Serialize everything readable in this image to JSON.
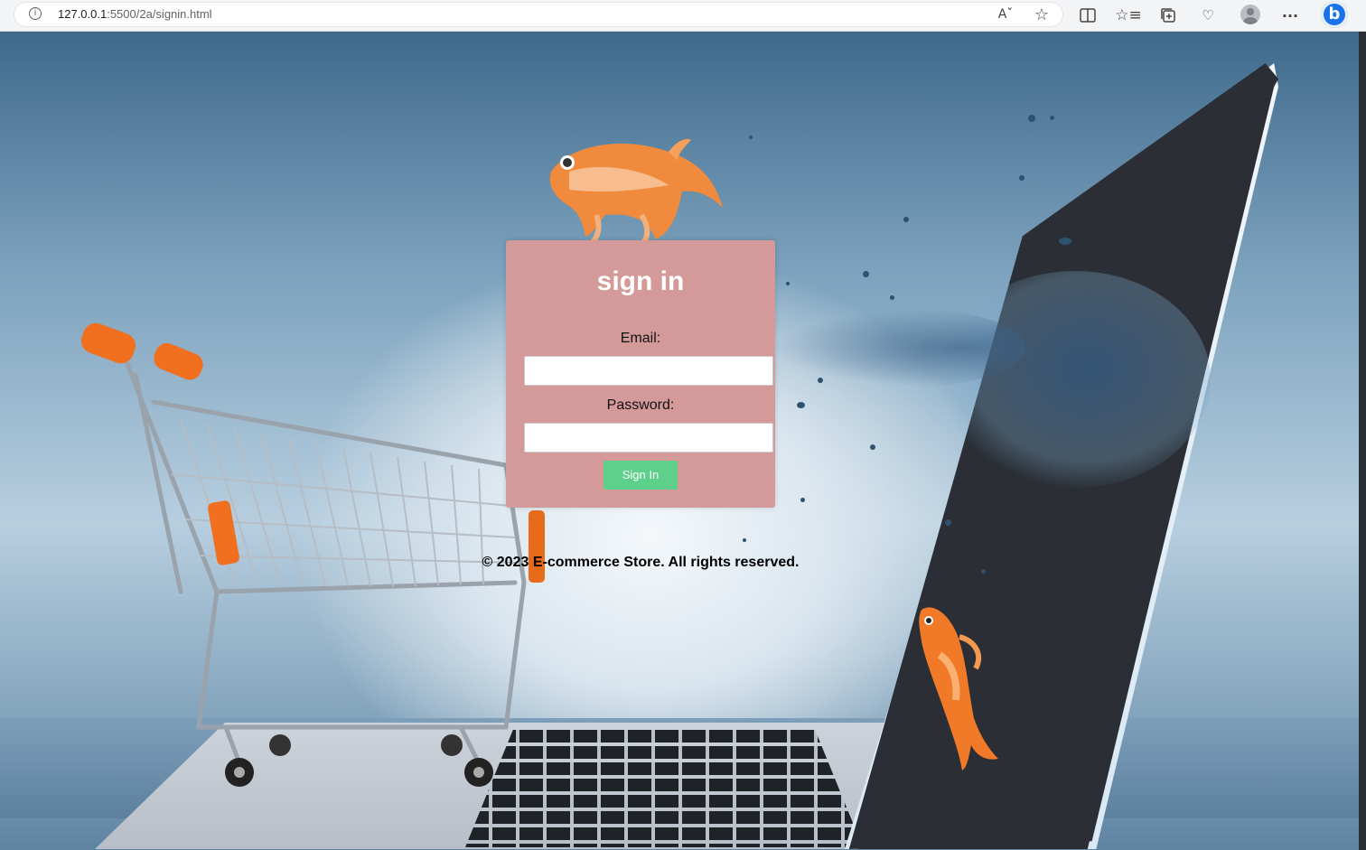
{
  "browser": {
    "url_host": "127.0.0.1",
    "url_rest": ":5500/2a/signin.html",
    "icons": [
      "info-icon",
      "read-aloud-icon",
      "favorite-star-icon",
      "split-screen-icon",
      "favorites-icon",
      "collections-icon",
      "performance-icon",
      "profile-avatar",
      "more-icon",
      "bing-copilot-icon"
    ]
  },
  "signin": {
    "title": "sign in",
    "email_label": "Email:",
    "email_value": "",
    "password_label": "Password:",
    "password_value": "",
    "submit_label": "Sign In"
  },
  "footer": {
    "text": "© 2023 E-commerce Store. All rights reserved."
  },
  "colors": {
    "card_bg": "#d49a9a",
    "button_bg": "#5fcf8c",
    "title_color": "#ffffff"
  }
}
